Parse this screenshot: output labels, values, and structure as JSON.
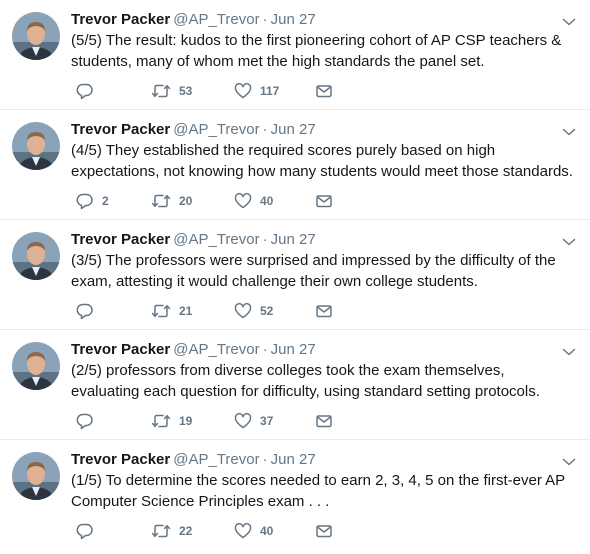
{
  "colors": {
    "icon_gray": "#657786",
    "text": "#14171a",
    "divider": "#e6ecf0"
  },
  "icons": {
    "reply": "speech-bubble",
    "retweet": "retweet-arrows",
    "like": "heart",
    "dm": "envelope",
    "menu": "chevron-down"
  },
  "tweets": [
    {
      "name": "Trevor Packer",
      "handle": "@AP_Trevor",
      "sep": "·",
      "date": "Jun 27",
      "text": "(5/5) The result: kudos to the first pioneering cohort of AP CSP teachers & students, many of whom met the high standards the panel set.",
      "replies": "",
      "retweets": "53",
      "likes": "117"
    },
    {
      "name": "Trevor Packer",
      "handle": "@AP_Trevor",
      "sep": "·",
      "date": "Jun 27",
      "text": "(4/5) They established the required scores purely based on high expectations, not knowing how many students would meet those standards.",
      "replies": "2",
      "retweets": "20",
      "likes": "40"
    },
    {
      "name": "Trevor Packer",
      "handle": "@AP_Trevor",
      "sep": "·",
      "date": "Jun 27",
      "text": "(3/5) The professors were surprised and impressed by the difficulty of the exam, attesting it would challenge their own college students.",
      "replies": "",
      "retweets": "21",
      "likes": "52"
    },
    {
      "name": "Trevor Packer",
      "handle": "@AP_Trevor",
      "sep": "·",
      "date": "Jun 27",
      "text": "(2/5) professors from diverse colleges took the exam themselves, evaluating each question for difficulty, using standard setting protocols.",
      "replies": "",
      "retweets": "19",
      "likes": "37"
    },
    {
      "name": "Trevor Packer",
      "handle": "@AP_Trevor",
      "sep": "·",
      "date": "Jun 27",
      "text": "(1/5) To determine the scores needed to earn 2, 3, 4, 5 on the first-ever AP Computer Science Principles exam . . .",
      "replies": "",
      "retweets": "22",
      "likes": "40"
    }
  ]
}
